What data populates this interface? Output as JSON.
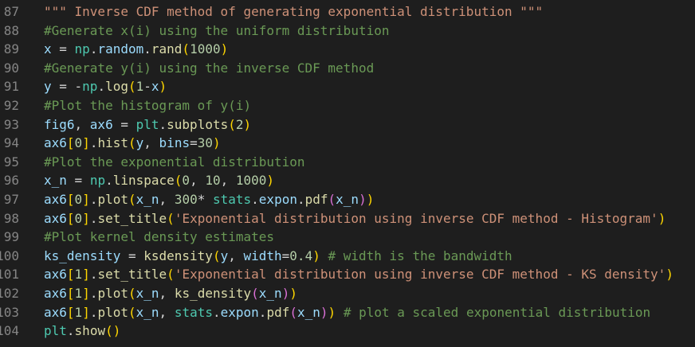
{
  "editor": {
    "lines": [
      {
        "num": "87",
        "tokens": [
          {
            "t": "\"\"\" Inverse CDF method of generating exponential distribution \"\"\"",
            "c": "str"
          }
        ]
      },
      {
        "num": "88",
        "tokens": [
          {
            "t": "#Generate x(i) using the uniform distribution",
            "c": "cmt"
          }
        ]
      },
      {
        "num": "89",
        "tokens": [
          {
            "t": "x",
            "c": "var"
          },
          {
            "t": " = ",
            "c": "op"
          },
          {
            "t": "np",
            "c": "mod"
          },
          {
            "t": ".",
            "c": "op"
          },
          {
            "t": "random",
            "c": "var"
          },
          {
            "t": ".",
            "c": "op"
          },
          {
            "t": "rand",
            "c": "fn"
          },
          {
            "t": "(",
            "c": "b1"
          },
          {
            "t": "1000",
            "c": "num"
          },
          {
            "t": ")",
            "c": "b1"
          }
        ]
      },
      {
        "num": "90",
        "tokens": [
          {
            "t": "#Generate y(i) using the inverse CDF method",
            "c": "cmt"
          }
        ]
      },
      {
        "num": "91",
        "tokens": [
          {
            "t": "y",
            "c": "var"
          },
          {
            "t": " = -",
            "c": "op"
          },
          {
            "t": "np",
            "c": "mod"
          },
          {
            "t": ".",
            "c": "op"
          },
          {
            "t": "log",
            "c": "fn"
          },
          {
            "t": "(",
            "c": "b1"
          },
          {
            "t": "1",
            "c": "num"
          },
          {
            "t": "-",
            "c": "op"
          },
          {
            "t": "x",
            "c": "var"
          },
          {
            "t": ")",
            "c": "b1"
          }
        ]
      },
      {
        "num": "92",
        "tokens": [
          {
            "t": "#Plot the histogram of y(i)",
            "c": "cmt"
          }
        ]
      },
      {
        "num": "93",
        "tokens": [
          {
            "t": "fig6",
            "c": "var"
          },
          {
            "t": ", ",
            "c": "op"
          },
          {
            "t": "ax6",
            "c": "var"
          },
          {
            "t": " = ",
            "c": "op"
          },
          {
            "t": "plt",
            "c": "mod"
          },
          {
            "t": ".",
            "c": "op"
          },
          {
            "t": "subplots",
            "c": "fn"
          },
          {
            "t": "(",
            "c": "b1"
          },
          {
            "t": "2",
            "c": "num"
          },
          {
            "t": ")",
            "c": "b1"
          }
        ]
      },
      {
        "num": "94",
        "tokens": [
          {
            "t": "ax6",
            "c": "var"
          },
          {
            "t": "[",
            "c": "b1"
          },
          {
            "t": "0",
            "c": "num"
          },
          {
            "t": "]",
            "c": "b1"
          },
          {
            "t": ".",
            "c": "op"
          },
          {
            "t": "hist",
            "c": "fn"
          },
          {
            "t": "(",
            "c": "b1"
          },
          {
            "t": "y",
            "c": "var"
          },
          {
            "t": ", ",
            "c": "op"
          },
          {
            "t": "bins",
            "c": "var"
          },
          {
            "t": "=",
            "c": "op"
          },
          {
            "t": "30",
            "c": "num"
          },
          {
            "t": ")",
            "c": "b1"
          }
        ]
      },
      {
        "num": "95",
        "tokens": [
          {
            "t": "#Plot the exponential distribution",
            "c": "cmt"
          }
        ]
      },
      {
        "num": "96",
        "tokens": [
          {
            "t": "x_n",
            "c": "var"
          },
          {
            "t": " = ",
            "c": "op"
          },
          {
            "t": "np",
            "c": "mod"
          },
          {
            "t": ".",
            "c": "op"
          },
          {
            "t": "linspace",
            "c": "fn"
          },
          {
            "t": "(",
            "c": "b1"
          },
          {
            "t": "0",
            "c": "num"
          },
          {
            "t": ", ",
            "c": "op"
          },
          {
            "t": "10",
            "c": "num"
          },
          {
            "t": ", ",
            "c": "op"
          },
          {
            "t": "1000",
            "c": "num"
          },
          {
            "t": ")",
            "c": "b1"
          }
        ]
      },
      {
        "num": "97",
        "tokens": [
          {
            "t": "ax6",
            "c": "var"
          },
          {
            "t": "[",
            "c": "b1"
          },
          {
            "t": "0",
            "c": "num"
          },
          {
            "t": "]",
            "c": "b1"
          },
          {
            "t": ".",
            "c": "op"
          },
          {
            "t": "plot",
            "c": "fn"
          },
          {
            "t": "(",
            "c": "b1"
          },
          {
            "t": "x_n",
            "c": "var"
          },
          {
            "t": ", ",
            "c": "op"
          },
          {
            "t": "300",
            "c": "num"
          },
          {
            "t": "* ",
            "c": "op"
          },
          {
            "t": "stats",
            "c": "mod"
          },
          {
            "t": ".",
            "c": "op"
          },
          {
            "t": "expon",
            "c": "var"
          },
          {
            "t": ".",
            "c": "op"
          },
          {
            "t": "pdf",
            "c": "fn"
          },
          {
            "t": "(",
            "c": "b2"
          },
          {
            "t": "x_n",
            "c": "var"
          },
          {
            "t": ")",
            "c": "b2"
          },
          {
            "t": ")",
            "c": "b1"
          }
        ]
      },
      {
        "num": "98",
        "tokens": [
          {
            "t": "ax6",
            "c": "var"
          },
          {
            "t": "[",
            "c": "b1"
          },
          {
            "t": "0",
            "c": "num"
          },
          {
            "t": "]",
            "c": "b1"
          },
          {
            "t": ".",
            "c": "op"
          },
          {
            "t": "set_title",
            "c": "fn"
          },
          {
            "t": "(",
            "c": "b1"
          },
          {
            "t": "'Exponential distribution using inverse CDF method - Histogram'",
            "c": "str"
          },
          {
            "t": ")",
            "c": "b1"
          }
        ]
      },
      {
        "num": "99",
        "tokens": [
          {
            "t": "#Plot kernel density estimates",
            "c": "cmt"
          }
        ]
      },
      {
        "num": "100",
        "tokens": [
          {
            "t": "ks_density",
            "c": "var"
          },
          {
            "t": " = ",
            "c": "op"
          },
          {
            "t": "ksdensity",
            "c": "fn"
          },
          {
            "t": "(",
            "c": "b1"
          },
          {
            "t": "y",
            "c": "var"
          },
          {
            "t": ", ",
            "c": "op"
          },
          {
            "t": "width",
            "c": "var"
          },
          {
            "t": "=",
            "c": "op"
          },
          {
            "t": "0.4",
            "c": "num"
          },
          {
            "t": ")",
            "c": "b1"
          },
          {
            "t": " ",
            "c": "op"
          },
          {
            "t": "# width is the bandwidth",
            "c": "cmt"
          }
        ]
      },
      {
        "num": "101",
        "tokens": [
          {
            "t": "ax6",
            "c": "var"
          },
          {
            "t": "[",
            "c": "b1"
          },
          {
            "t": "1",
            "c": "num"
          },
          {
            "t": "]",
            "c": "b1"
          },
          {
            "t": ".",
            "c": "op"
          },
          {
            "t": "set_title",
            "c": "fn"
          },
          {
            "t": "(",
            "c": "b1"
          },
          {
            "t": "'Exponential distribution using inverse CDF method - KS density'",
            "c": "str"
          },
          {
            "t": ")",
            "c": "b1"
          }
        ]
      },
      {
        "num": "102",
        "tokens": [
          {
            "t": "ax6",
            "c": "var"
          },
          {
            "t": "[",
            "c": "b1"
          },
          {
            "t": "1",
            "c": "num"
          },
          {
            "t": "]",
            "c": "b1"
          },
          {
            "t": ".",
            "c": "op"
          },
          {
            "t": "plot",
            "c": "fn"
          },
          {
            "t": "(",
            "c": "b1"
          },
          {
            "t": "x_n",
            "c": "var"
          },
          {
            "t": ", ",
            "c": "op"
          },
          {
            "t": "ks_density",
            "c": "fn"
          },
          {
            "t": "(",
            "c": "b2"
          },
          {
            "t": "x_n",
            "c": "var"
          },
          {
            "t": ")",
            "c": "b2"
          },
          {
            "t": ")",
            "c": "b1"
          }
        ]
      },
      {
        "num": "103",
        "tokens": [
          {
            "t": "ax6",
            "c": "var"
          },
          {
            "t": "[",
            "c": "b1"
          },
          {
            "t": "1",
            "c": "num"
          },
          {
            "t": "]",
            "c": "b1"
          },
          {
            "t": ".",
            "c": "op"
          },
          {
            "t": "plot",
            "c": "fn"
          },
          {
            "t": "(",
            "c": "b1"
          },
          {
            "t": "x_n",
            "c": "var"
          },
          {
            "t": ", ",
            "c": "op"
          },
          {
            "t": "stats",
            "c": "mod"
          },
          {
            "t": ".",
            "c": "op"
          },
          {
            "t": "expon",
            "c": "var"
          },
          {
            "t": ".",
            "c": "op"
          },
          {
            "t": "pdf",
            "c": "fn"
          },
          {
            "t": "(",
            "c": "b2"
          },
          {
            "t": "x_n",
            "c": "var"
          },
          {
            "t": ")",
            "c": "b2"
          },
          {
            "t": ")",
            "c": "b1"
          },
          {
            "t": " ",
            "c": "op"
          },
          {
            "t": "# plot a scaled exponential distribution",
            "c": "cmt"
          }
        ]
      },
      {
        "num": "104",
        "tokens": [
          {
            "t": "plt",
            "c": "mod"
          },
          {
            "t": ".",
            "c": "op"
          },
          {
            "t": "show",
            "c": "fn"
          },
          {
            "t": "(",
            "c": "b1"
          },
          {
            "t": ")",
            "c": "b1"
          }
        ]
      }
    ]
  }
}
